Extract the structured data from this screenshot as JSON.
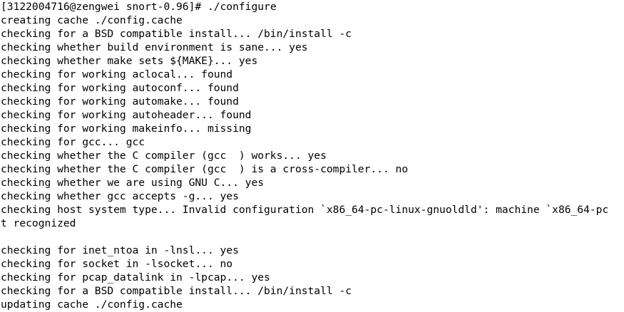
{
  "terminal": {
    "prompt": "[3122004716@zengwei snort-0.96]# ",
    "command": "./configure",
    "lines": [
      "creating cache ./config.cache",
      "checking for a BSD compatible install... /bin/install -c",
      "checking whether build environment is sane... yes",
      "checking whether make sets ${MAKE}... yes",
      "checking for working aclocal... found",
      "checking for working autoconf... found",
      "checking for working automake... found",
      "checking for working autoheader... found",
      "checking for working makeinfo... missing",
      "checking for gcc... gcc",
      "checking whether the C compiler (gcc  ) works... yes",
      "checking whether the C compiler (gcc  ) is a cross-compiler... no",
      "checking whether we are using GNU C... yes",
      "checking whether gcc accepts -g... yes",
      "checking host system type... Invalid configuration `x86_64-pc-linux-gnuoldld': machine `x86_64-pc",
      "t recognized",
      "",
      "checking for inet_ntoa in -lnsl... yes",
      "checking for socket in -lsocket... no",
      "checking for pcap_datalink in -lpcap... yes",
      "checking for a BSD compatible install... /bin/install -c",
      "updating cache ./config.cache"
    ]
  }
}
